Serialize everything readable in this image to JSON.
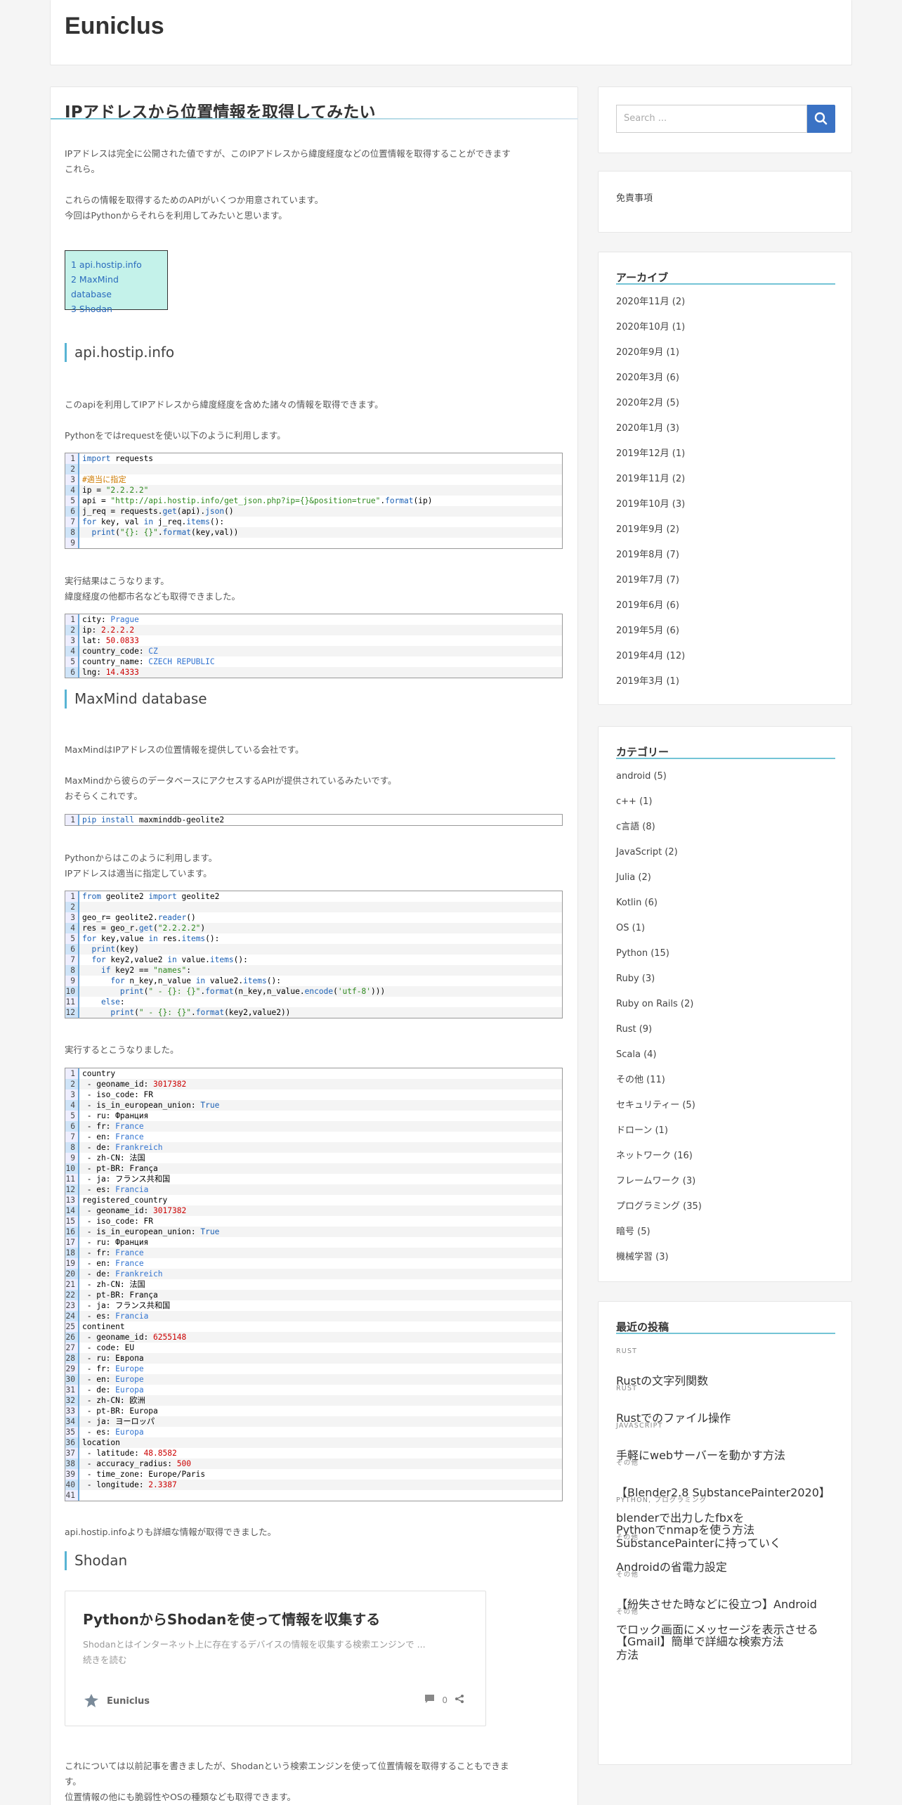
{
  "site": {
    "title": "Euniclus"
  },
  "post": {
    "title": "IPアドレスから位置情報を取得してみたい",
    "intro1": "IPアドレスは完全に公開された値ですが、このIPアドレスから緯度経度などの位置情報を取得することができます",
    "intro2": "これらの情報を取得するためのAPIがいくつか用意されています。",
    "intro3": "今回はPythonからそれらを利用してみたいと思います。",
    "intro1b": "これら。",
    "toc": [
      "1 api.hostip.info",
      "2 MaxMind database",
      "3 Shodan"
    ],
    "s1_title": "api.hostip.info",
    "s1_p1": "このapiを利用してIPアドレスから緯度経度を含めた諸々の情報を取得できます。",
    "s1_p2": "Pythonをではrequestを使い以下のように利用します。",
    "s1_p3": "実行結果はこうなります。",
    "s1_p4": "緯度経度の他都市名なども取得できました。",
    "s2_title": "MaxMind database",
    "s2_p1": "MaxMindはIPアドレスの位置情報を提供している会社です。",
    "s2_p2": "MaxMindから彼らのデータベースにアクセスするAPIが提供されているみたいです。",
    "s2_p3": "おそらくこれです。",
    "s2_p4": "Pythonからはこのように利用します。",
    "s2_p5": "IPアドレスは適当に指定しています。",
    "s2_p6": "実行するとこうなりました。",
    "s2_p7": "api.hostip.infoよりも詳細な情報が取得できました。",
    "s3_title": "Shodan",
    "s3_p1": "これについては以前記事を書きましたが、Shodanという検索エンジンを使って位置情報を取得することもできま",
    "s3_p1b": "す。",
    "s3_p2": "位置情報の他にも脆弱性やOSの種類なども取得できます。"
  },
  "card": {
    "title": "PythonからShodanを使って情報を収集する",
    "excerpt": "Shodanとはインターネット上に存在するデバイスの情報を収集する検索エンジンで ...",
    "more": "続きを読む",
    "author": "Euniclus",
    "comments": "0"
  },
  "sidebar": {
    "search_placeholder": "Search ...",
    "disclaimer": "免責事項",
    "archive_title": "アーカイブ",
    "archives": [
      "2020年11月 (2)",
      "2020年10月 (1)",
      "2020年9月 (1)",
      "2020年3月 (6)",
      "2020年2月 (5)",
      "2020年1月 (3)",
      "2019年12月 (1)",
      "2019年11月 (2)",
      "2019年10月 (3)",
      "2019年9月 (2)",
      "2019年8月 (7)",
      "2019年7月 (7)",
      "2019年6月 (6)",
      "2019年5月 (6)",
      "2019年4月 (12)",
      "2019年3月 (1)"
    ],
    "category_title": "カテゴリー",
    "categories": [
      "android (5)",
      "c++ (1)",
      "c言語 (8)",
      "JavaScript (2)",
      "Julia (2)",
      "Kotlin (6)",
      "OS (1)",
      "Python (15)",
      "Ruby (3)",
      "Ruby on Rails (2)",
      "Rust (9)",
      "Scala (4)",
      "その他 (11)",
      "セキュリティー (5)",
      "ドローン (1)",
      "ネットワーク (16)",
      "フレームワーク (3)",
      "プログラミング (35)",
      "暗号 (5)",
      "機械学習 (3)"
    ],
    "recent_title": "最近の投稿",
    "recent": [
      {
        "cat": "RUST",
        "title": [
          "Rustの文字列関数"
        ]
      },
      {
        "cat": "RUST",
        "title": [
          "Rustでのファイル操作"
        ]
      },
      {
        "cat": "JAVASCRIPT",
        "title": [
          "手軽にwebサーバーを動かす方法"
        ]
      },
      {
        "cat": "その他",
        "title": [
          "【Blender2.8 SubstancePainter2020】",
          "blenderで出力したfbxを",
          "SubstancePainterに持っていく"
        ]
      },
      {
        "cat": "PYTHON, プログラミング",
        "title": [
          "Pythonでnmapを使う方法"
        ]
      },
      {
        "cat": "その他",
        "title": [
          "Androidの省電力設定"
        ]
      },
      {
        "cat": "その他",
        "title": [
          "【紛失させた時などに役立つ】Android",
          "でロック画面にメッセージを表示させる",
          "方法"
        ]
      },
      {
        "cat": "その他",
        "title": [
          "【Gmail】簡単で詳細な検索方法"
        ]
      }
    ]
  },
  "code1": [
    "<span class='kw'>import</span> requests",
    "",
    "<span class='cm'>#適当に指定</span>",
    "ip = <span class='str'>\"2.2.2.2\"</span>",
    "api = <span class='str'>\"http://api.hostip.info/get_json.php?ip={}&amp;position=true\"</span>.<span class='kw'>format</span>(ip)",
    "j_req = requests.<span class='kw'>get</span>(api).<span class='kw'>json</span>()",
    "<span class='kw'>for</span> key, val <span class='kw'>in</span> j_req.<span class='kw'>items</span>():",
    "  <span class='kw'>print</span>(<span class='str'>\"{}: {}\"</span>.<span class='kw'>format</span>(key,val))",
    ""
  ],
  "code2": [
    "city: <span class='bl'>Prague</span>",
    "ip: <span class='num'>2.2.2.2</span>",
    "lat: <span class='num'>50.0833</span>",
    "country_code: <span class='bl'>CZ</span>",
    "country_name: <span class='bl'>CZECH REPUBLIC</span>",
    "lng: <span class='num'>14.4333</span>"
  ],
  "code3": [
    "<span class='kw'>pip install</span> maxminddb-geolite2"
  ],
  "code4": [
    "<span class='kw'>from</span> geolite2 <span class='kw'>import</span> geolite2",
    "",
    "geo_r= geolite2.<span class='kw'>reader</span>()",
    "res = geo_r.<span class='kw'>get</span>(<span class='str'>\"2.2.2.2\"</span>)",
    "<span class='kw'>for</span> key,value <span class='kw'>in</span> res.<span class='kw'>items</span>():",
    "  <span class='kw'>print</span>(key)",
    "  <span class='kw'>for</span> key2,value2 <span class='kw'>in</span> value.<span class='kw'>items</span>():",
    "    <span class='kw'>if</span> key2 == <span class='str'>\"names\"</span>:",
    "      <span class='kw'>for</span> n_key,n_value <span class='kw'>in</span> value2.<span class='kw'>items</span>():",
    "        <span class='kw'>print</span>(<span class='str'>\" - {}: {}\"</span>.<span class='kw'>format</span>(n_key,n_value.<span class='kw'>encode</span>(<span class='str'>'utf-8'</span>)))",
    "    <span class='kw'>else</span>:",
    "      <span class='kw'>print</span>(<span class='str'>\" - {}: {}\"</span>.<span class='kw'>format</span>(key2,value2))"
  ],
  "code5": [
    "country",
    " - geoname_id: <span class='num'>3017382</span>",
    " - iso_code: FR",
    " - is_in_european_union: <span class='kw'>True</span>",
    " - ru: Франция",
    " - fr: <span class='bl'>France</span>",
    " - en: <span class='bl'>France</span>",
    " - de: <span class='bl'>Frankreich</span>",
    " - zh-CN: 法国",
    " - pt-BR: França",
    " - ja: フランス共和国",
    " - es: <span class='bl'>Francia</span>",
    "registered_country",
    " - geoname_id: <span class='num'>3017382</span>",
    " - iso_code: FR",
    " - is_in_european_union: <span class='kw'>True</span>",
    " - ru: Франция",
    " - fr: <span class='bl'>France</span>",
    " - en: <span class='bl'>France</span>",
    " - de: <span class='bl'>Frankreich</span>",
    " - zh-CN: 法国",
    " - pt-BR: França",
    " - ja: フランス共和国",
    " - es: <span class='bl'>Francia</span>",
    "continent",
    " - geoname_id: <span class='num'>6255148</span>",
    " - code: EU",
    " - ru: Европа",
    " - fr: <span class='bl'>Europe</span>",
    " - en: <span class='bl'>Europe</span>",
    " - de: <span class='bl'>Europa</span>",
    " - zh-CN: 欧洲",
    " - pt-BR: Europa",
    " - ja: ヨーロッパ",
    " - es: <span class='bl'>Europa</span>",
    "location",
    " - latitude: <span class='num'>48.8582</span>",
    " - accuracy_radius: <span class='num'>500</span>",
    " - time_zone: Europe/Paris",
    " - longitude: <span class='num'>2.3387</span>",
    ""
  ]
}
